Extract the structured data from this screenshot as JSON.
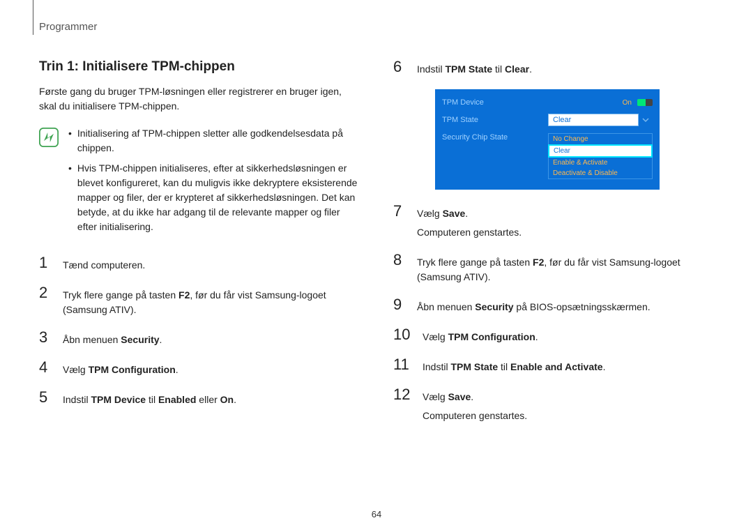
{
  "header": "Programmer",
  "title": "Trin 1: Initialisere TPM-chippen",
  "intro": "Første gang du bruger TPM-løsningen eller registrerer en bruger igen, skal du initialisere TPM-chippen.",
  "notes": {
    "item1": "Initialisering af TPM-chippen sletter alle godkendelsesdata på chippen.",
    "item2": "Hvis TPM-chippen initialiseres, efter at sikkerhedsløsningen er blevet konfigureret, kan du muligvis ikke dekryptere eksisterende mapper og filer, der er krypteret af sikkerhedsløsningen. Det kan betyde, at du ikke har adgang til de relevante mapper og filer efter initialisering."
  },
  "steps": {
    "s1": "Tænd computeren.",
    "s2_a": "Tryk flere gange på tasten ",
    "s2_b": "F2",
    "s2_c": ", før du får vist Samsung-logoet (Samsung ATIV).",
    "s3_a": "Åbn menuen ",
    "s3_b": "Security",
    "s3_c": ".",
    "s4_a": "Vælg ",
    "s4_b": "TPM Configuration",
    "s4_c": ".",
    "s5_a": "Indstil ",
    "s5_b": "TPM Device",
    "s5_c": " til ",
    "s5_d": "Enabled",
    "s5_e": " eller ",
    "s5_f": "On",
    "s5_g": ".",
    "s6_a": "Indstil ",
    "s6_b": "TPM State",
    "s6_c": " til ",
    "s6_d": "Clear",
    "s6_e": ".",
    "s7_a": "Vælg ",
    "s7_b": "Save",
    "s7_c": ".",
    "s7_sub": "Computeren genstartes.",
    "s8_a": "Tryk flere gange på tasten ",
    "s8_b": "F2",
    "s8_c": ", før du får vist Samsung-logoet (Samsung ATIV).",
    "s9_a": "Åbn menuen ",
    "s9_b": "Security",
    "s9_c": " på BIOS-opsætningsskærmen.",
    "s10_a": "Vælg ",
    "s10_b": "TPM Configuration",
    "s10_c": ".",
    "s11_a": "Indstil ",
    "s11_b": "TPM State",
    "s11_c": " til ",
    "s11_d": "Enable and Activate",
    "s11_e": ".",
    "s12_a": "Vælg ",
    "s12_b": "Save",
    "s12_c": ".",
    "s12_sub": "Computeren genstartes."
  },
  "bios": {
    "row1_label": "TPM Device",
    "row1_val": "On",
    "row2_label": "TPM State",
    "row2_val": "Clear",
    "row3_label": "Security Chip State",
    "opt1": "No Change",
    "opt2": "Clear",
    "opt3": "Enable & Activate",
    "opt4": "Deactivate & Disable"
  },
  "page_num": "64"
}
